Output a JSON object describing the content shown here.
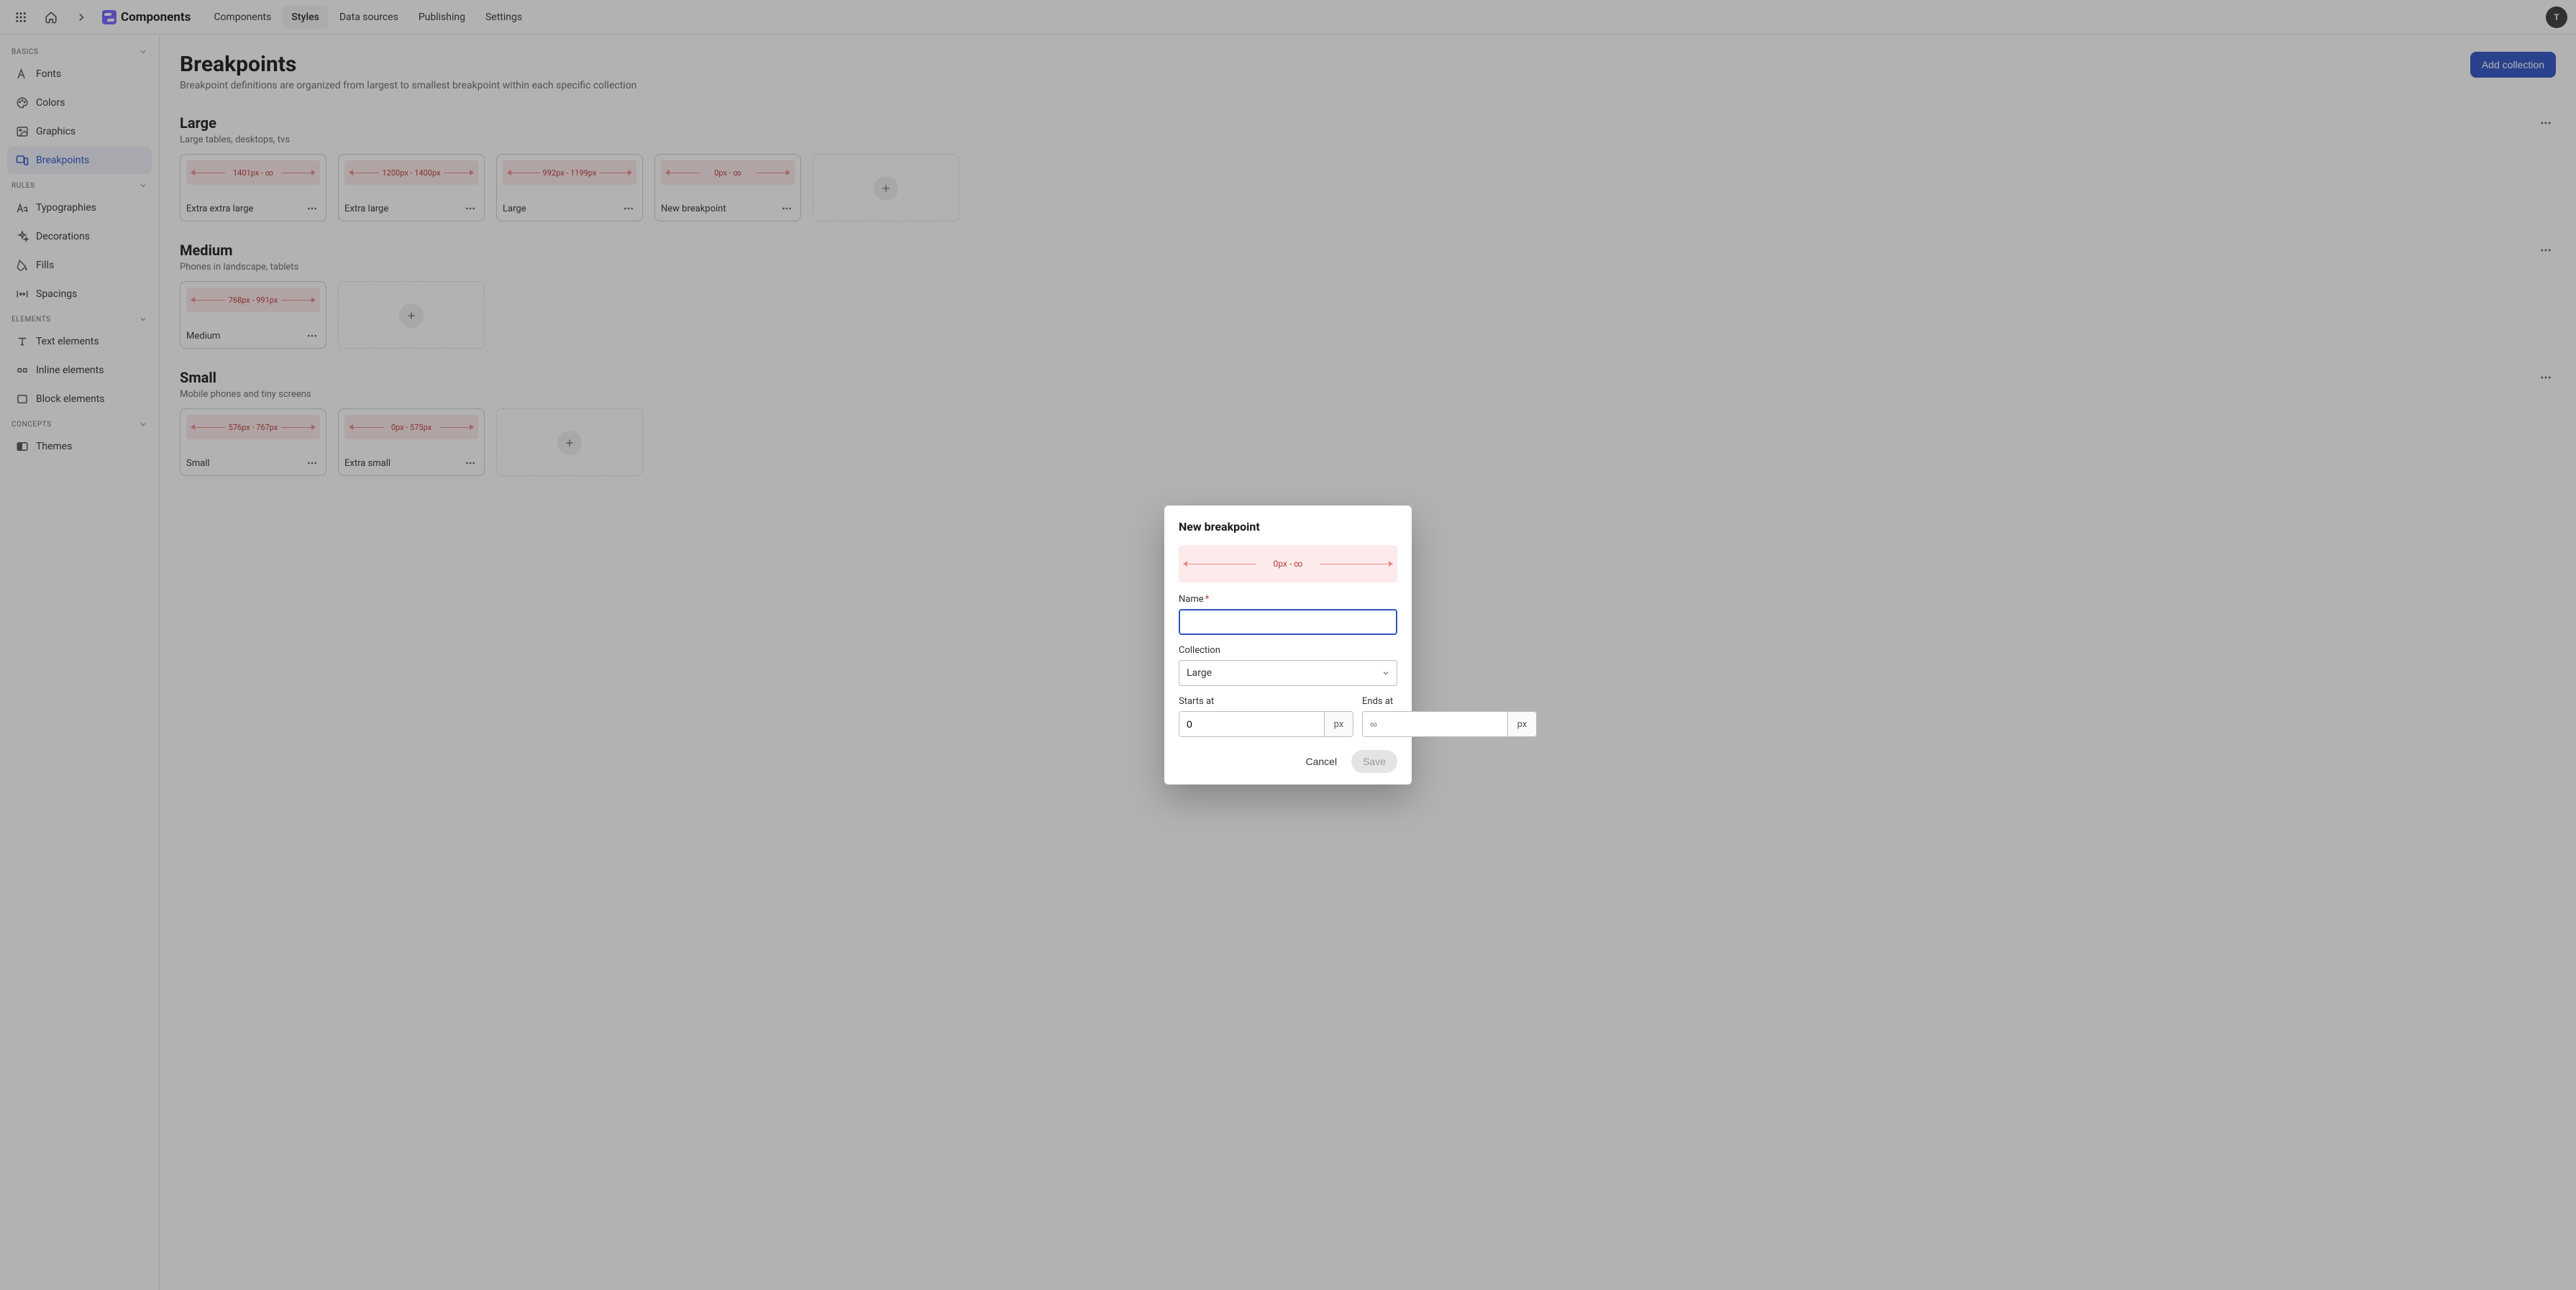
{
  "brand": {
    "name": "Components"
  },
  "topnav": {
    "items": [
      {
        "label": "Components",
        "active": false
      },
      {
        "label": "Styles",
        "active": true
      },
      {
        "label": "Data sources",
        "active": false
      },
      {
        "label": "Publishing",
        "active": false
      },
      {
        "label": "Settings",
        "active": false
      }
    ]
  },
  "avatar": {
    "initials": "T"
  },
  "sidebar": {
    "sections": [
      {
        "title": "BASICS",
        "items": [
          {
            "label": "Fonts",
            "icon": "fonts-icon",
            "active": false
          },
          {
            "label": "Colors",
            "icon": "palette-icon",
            "active": false
          },
          {
            "label": "Graphics",
            "icon": "image-icon",
            "active": false
          },
          {
            "label": "Breakpoints",
            "icon": "breakpoints-icon",
            "active": true
          }
        ]
      },
      {
        "title": "RULES",
        "items": [
          {
            "label": "Typographies",
            "icon": "type-icon",
            "active": false
          },
          {
            "label": "Decorations",
            "icon": "sparkle-icon",
            "active": false
          },
          {
            "label": "Fills",
            "icon": "fill-icon",
            "active": false
          },
          {
            "label": "Spacings",
            "icon": "spacing-icon",
            "active": false
          }
        ]
      },
      {
        "title": "ELEMENTS",
        "items": [
          {
            "label": "Text elements",
            "icon": "text-icon",
            "active": false
          },
          {
            "label": "Inline elements",
            "icon": "inline-icon",
            "active": false
          },
          {
            "label": "Block elements",
            "icon": "block-icon",
            "active": false
          }
        ]
      },
      {
        "title": "CONCEPTS",
        "items": [
          {
            "label": "Themes",
            "icon": "theme-icon",
            "active": false
          }
        ]
      }
    ]
  },
  "page": {
    "title": "Breakpoints",
    "subtitle": "Breakpoint definitions are organized from largest to smallest breakpoint within each specific collection",
    "add_button": "Add collection"
  },
  "collections": [
    {
      "title": "Large",
      "subtitle": "Large tables, desktops, tvs",
      "cards": [
        {
          "name": "Extra extra large",
          "range": "1401px - ∞"
        },
        {
          "name": "Extra large",
          "range": "1200px - 1400px"
        },
        {
          "name": "Large",
          "range": "992px - 1199px"
        },
        {
          "name": "New breakpoint",
          "range": "0px - ∞"
        }
      ]
    },
    {
      "title": "Medium",
      "subtitle": "Phones in landscape, tablets",
      "cards": [
        {
          "name": "Medium",
          "range": "768px - 991px"
        }
      ]
    },
    {
      "title": "Small",
      "subtitle": "Mobile phones and tiny screens",
      "cards": [
        {
          "name": "Small",
          "range": "576px - 767px"
        },
        {
          "name": "Extra small",
          "range": "0px - 575px"
        }
      ]
    }
  ],
  "modal": {
    "title": "New breakpoint",
    "preview_range": "0px - ∞",
    "fields": {
      "name_label": "Name",
      "name_value": "",
      "name_placeholder": "",
      "collection_label": "Collection",
      "collection_value": "Large",
      "starts_label": "Starts at",
      "starts_value": "0",
      "starts_unit": "px",
      "ends_label": "Ends at",
      "ends_value": "",
      "ends_placeholder": "∞",
      "ends_unit": "px"
    },
    "actions": {
      "cancel": "Cancel",
      "save": "Save"
    }
  }
}
